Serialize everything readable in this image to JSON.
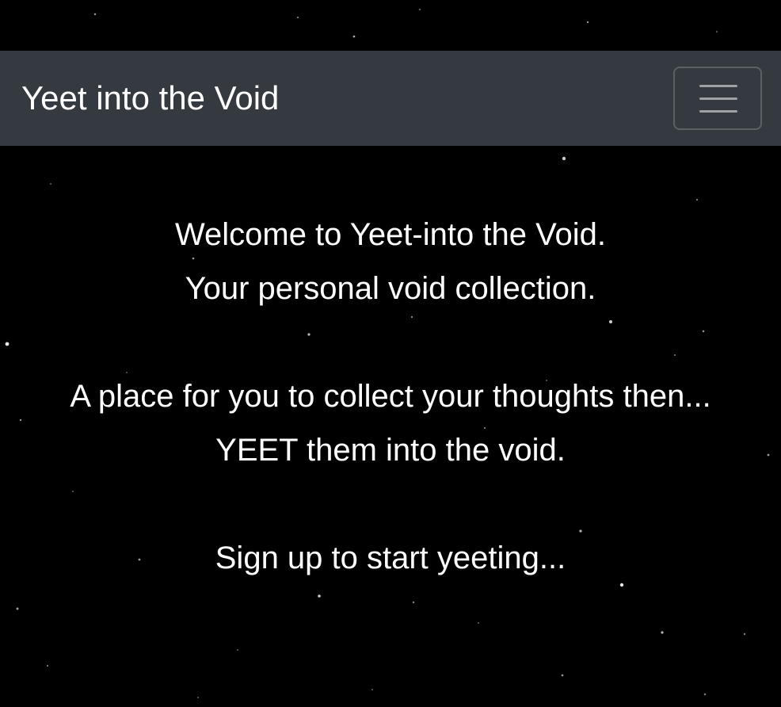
{
  "navbar": {
    "brand": "Yeet into the Void",
    "toggler_icon": "hamburger-menu-icon"
  },
  "intro": {
    "line1": "Welcome to Yeet-into the Void.",
    "line2": "Your personal void collection.",
    "line3": "A place for you to collect your thoughts then...",
    "line4": "YEET them into the void.",
    "line5": "Sign up to start yeeting..."
  },
  "colors": {
    "background": "#000000",
    "navbar": "#343a40",
    "text": "#ffffff",
    "toggler_border": "#5b6065",
    "toggler_bars": "#9fa3a7"
  }
}
